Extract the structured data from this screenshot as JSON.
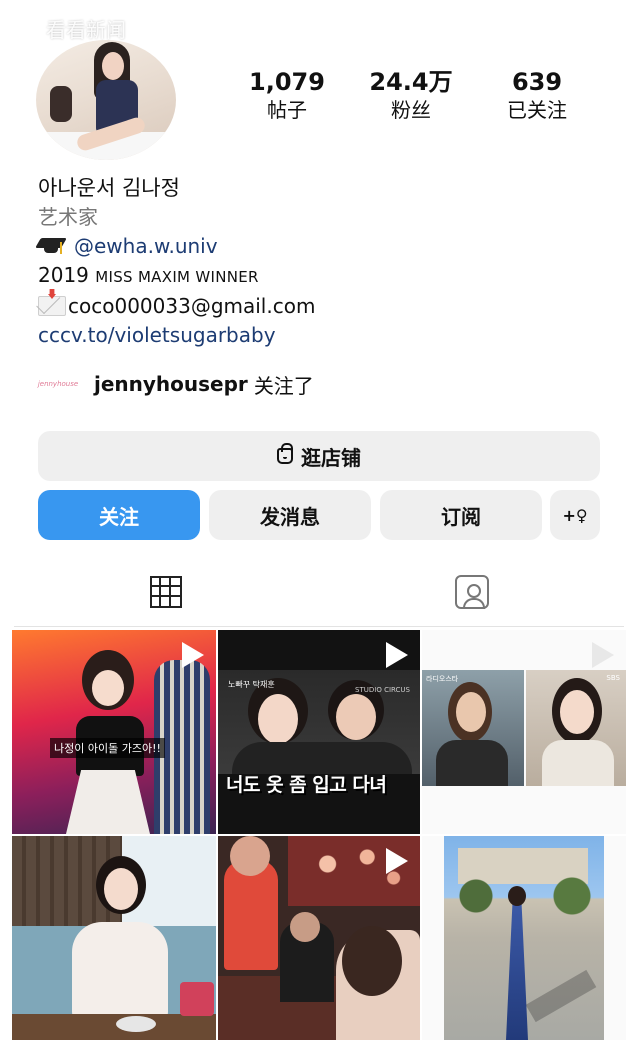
{
  "watermark": {
    "text": "看看新闻"
  },
  "profile": {
    "stats": [
      {
        "value": "1,079",
        "label": "帖子"
      },
      {
        "value": "24.4万",
        "label": "粉丝"
      },
      {
        "value": "639",
        "label": "已关注"
      }
    ],
    "name": "아나운서 김나정",
    "category": "艺术家",
    "bio_handle": "@ewha.w.univ",
    "bio_line_prefix": "2019 ",
    "bio_line_caps": "MISS MAXIM WINNER",
    "email": "coco000033@gmail.com",
    "link": "cccv.to/violetsugarbaby",
    "followed_by": {
      "avatar_text": "jennyhouse",
      "username": "jennyhousepr",
      "suffix": "关注了"
    }
  },
  "buttons": {
    "shop": "逛店铺",
    "follow": "关注",
    "message": "发消息",
    "subscribe": "订阅",
    "add_person": "+♀"
  },
  "tabs": {
    "grid_icon": "grid-icon",
    "tagged_icon": "tagged-icon"
  },
  "posts": {
    "p1_caption": "나정이 아이돌 가즈아!!",
    "p2_title": "너도 옷 좀 입고 다녀",
    "p2_logo": "노빠꾸 탁재훈",
    "p2_studio": "STUDIO CIRCUS",
    "p3_tag": "라디오스타",
    "p3_sbs": "SBS"
  },
  "colors": {
    "accent": "#3897f0",
    "button_bg": "#efefef",
    "link": "#1d3c73",
    "muted": "#777777"
  }
}
